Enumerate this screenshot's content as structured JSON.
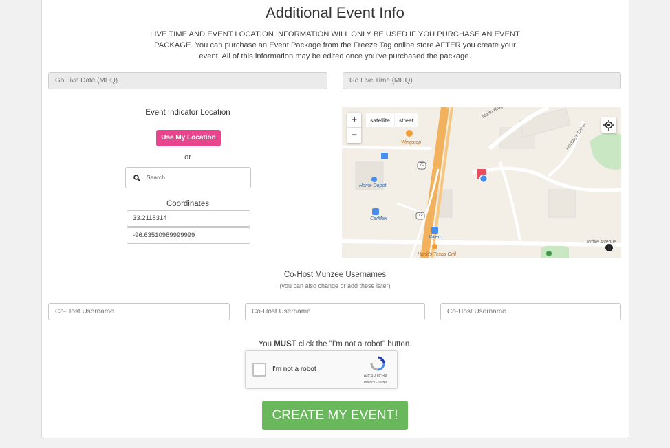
{
  "header": {
    "title": "Additional Event Info",
    "notice": "LIVE TIME AND EVENT LOCATION INFORMATION WILL ONLY BE USED IF YOU PURCHASE AN EVENT PACKAGE. You can purchase an Event Package from the Freeze Tag online store AFTER you create your event. All of this information may be edited once you've purchased the package."
  },
  "golive": {
    "date_placeholder": "Go Live Date (MHQ)",
    "time_placeholder": "Go Live Time (MHQ)"
  },
  "location": {
    "title": "Event Indicator Location",
    "use_location_label": "Use My Location",
    "or_label": "or",
    "search_placeholder": "Search",
    "coordinates_label": "Coordinates",
    "latitude": "33.2118314",
    "longitude": "-96.63510989999999"
  },
  "map": {
    "zoom_in": "+",
    "zoom_out": "−",
    "type_satellite": "satellite",
    "type_street": "street",
    "info": "i",
    "labels": {
      "north_ridge": "North Ridge",
      "heritage": "Heritage Drive",
      "wingstop": "Wingstop",
      "home_depot": "Home Depot",
      "carmax": "CarMax",
      "valero": "Valero",
      "hanks": "Hank's Texas Grill",
      "white": "White Avenue",
      "hwy": "75"
    },
    "colors": {
      "highway": "#f2b15c",
      "road": "#ffffff",
      "water": "#aadaff",
      "park": "#c9e7c2",
      "pin": "#4a8df0"
    }
  },
  "cohost": {
    "title": "Co-Host Munzee Usernames",
    "subtitle": "(you can also change or add these later)",
    "placeholders": [
      "Co-Host Username",
      "Co-Host Username",
      "Co-Host Username"
    ]
  },
  "captcha": {
    "must_prefix": "You ",
    "must_bold": "MUST",
    "must_suffix": " click the \"I'm not a robot\" button.",
    "checkbox_label": "I'm not a robot",
    "brand": "reCAPTCHA",
    "terms": "Privacy - Terms"
  },
  "submit": {
    "label": "CREATE MY EVENT!"
  },
  "colors": {
    "pink_button": "#e9448e",
    "green_button": "#6ab85c"
  }
}
